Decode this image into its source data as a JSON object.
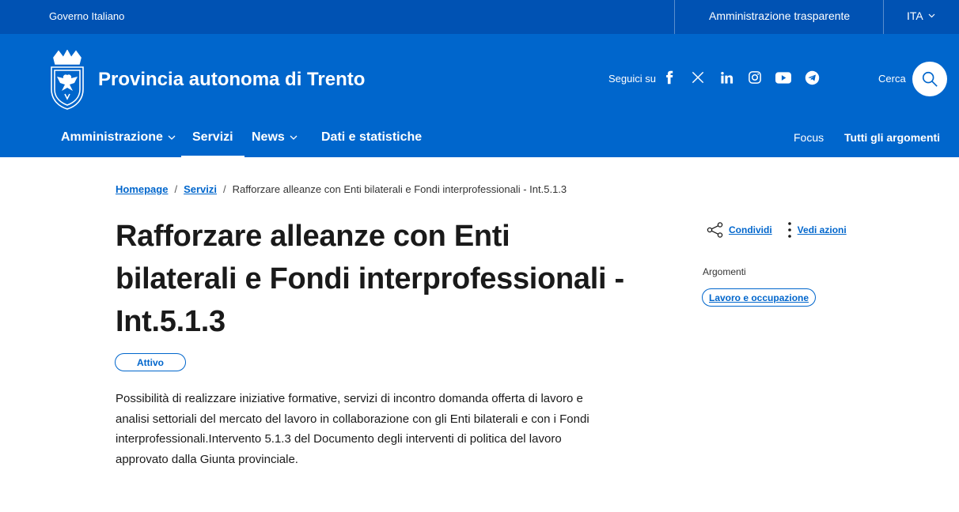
{
  "slim_header": {
    "gov_label": "Governo Italiano",
    "transparency_label": "Amministrazione trasparente",
    "language": "ITA"
  },
  "header": {
    "brand_title": "Provincia autonoma di Trento",
    "follow_label": "Seguici su",
    "socials": [
      "facebook-icon",
      "x-icon",
      "linkedin-icon",
      "instagram-icon",
      "youtube-icon",
      "telegram-icon"
    ],
    "search_label": "Cerca"
  },
  "nav": {
    "items": [
      {
        "label": "Amministrazione",
        "has_dropdown": true
      },
      {
        "label": "Servizi",
        "active": true
      },
      {
        "label": "News",
        "has_dropdown": true
      },
      {
        "label": "Dati e statistiche"
      }
    ],
    "right_items": [
      {
        "label": "Focus"
      },
      {
        "label": "Tutti gli argomenti"
      }
    ]
  },
  "breadcrumb": {
    "items": [
      "Homepage",
      "Servizi",
      "Rafforzare alleanze con Enti bilaterali e Fondi interprofessionali - Int.5.1.3"
    ]
  },
  "page": {
    "title": "Rafforzare alleanze con Enti bilaterali e Fondi interprofessionali - Int.5.1.3",
    "status": "Attivo",
    "description": "Possibilità di realizzare iniziative formative, servizi di incontro domanda offerta di lavoro e analisi settoriali del mercato del lavoro in collaborazione con gli Enti bilaterali e con i Fondi interprofessionali.Intervento 5.1.3 del Documento degli interventi di politica del lavoro approvato dalla Giunta provinciale."
  },
  "sidebar": {
    "share_label": "Condividi",
    "actions_label": "Vedi azioni",
    "topics_label": "Argomenti",
    "topics": [
      "Lavoro e occupazione"
    ]
  },
  "colors": {
    "slim_bg": "#0052b3",
    "header_bg": "#0066cc",
    "accent": "#0066cc"
  }
}
